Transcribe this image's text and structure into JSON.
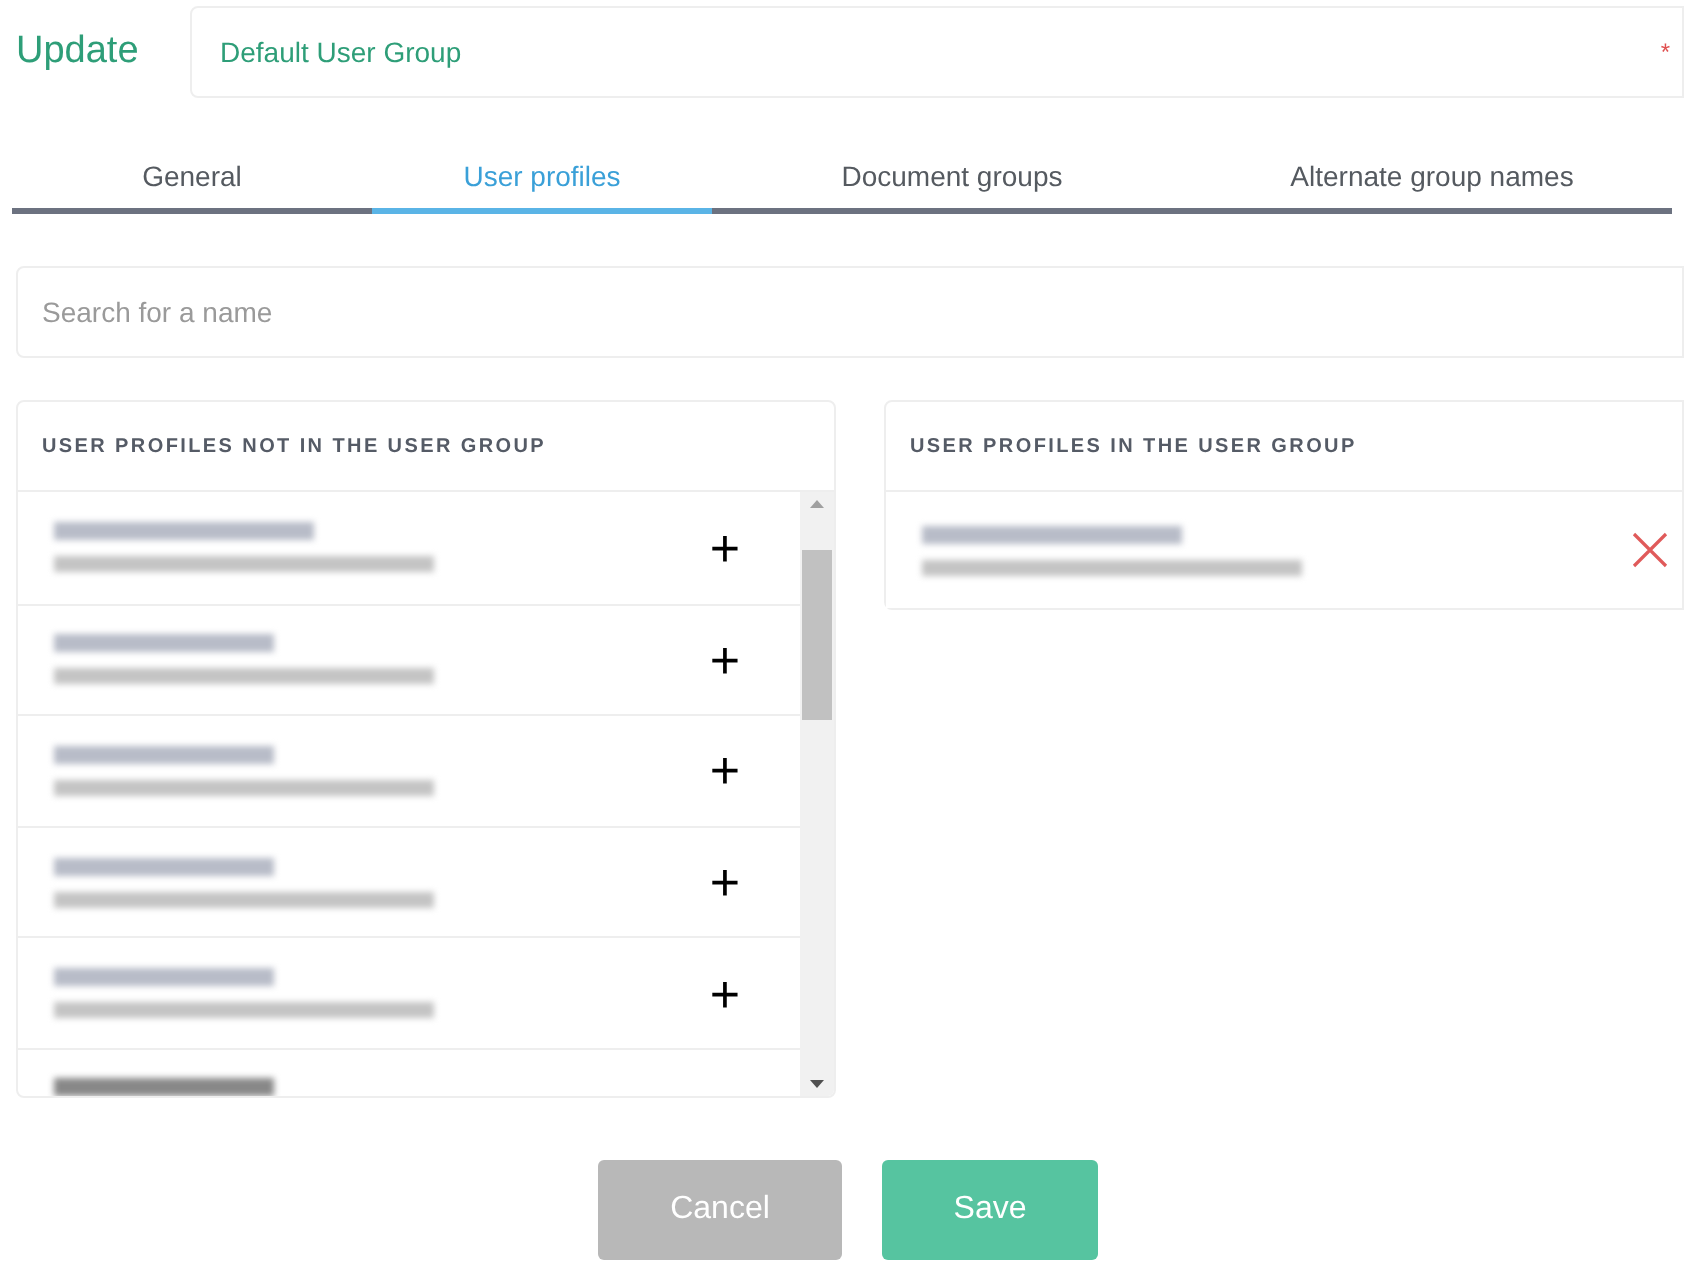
{
  "header": {
    "title": "Update",
    "group_name": "Default User Group",
    "required_mark": "*"
  },
  "tabs": [
    {
      "label": "General",
      "selected": false
    },
    {
      "label": "User profiles",
      "selected": true
    },
    {
      "label": "Document groups",
      "selected": false
    },
    {
      "label": "Alternate group names",
      "selected": false
    }
  ],
  "search": {
    "placeholder": "Search for a name"
  },
  "available_panel": {
    "title": "USER PROFILES NOT IN THE USER GROUP",
    "add_symbol": "+",
    "profiles": [
      {
        "kind": "redacted"
      },
      {
        "kind": "redacted"
      },
      {
        "kind": "redacted"
      },
      {
        "kind": "redacted"
      },
      {
        "kind": "redacted"
      }
    ]
  },
  "member_panel": {
    "title": "USER PROFILES IN THE USER GROUP",
    "profiles": [
      {
        "kind": "redacted"
      }
    ]
  },
  "buttons": [
    {
      "label": "Cancel",
      "kind": "secondary"
    },
    {
      "label": "Save",
      "kind": "primary"
    }
  ]
}
